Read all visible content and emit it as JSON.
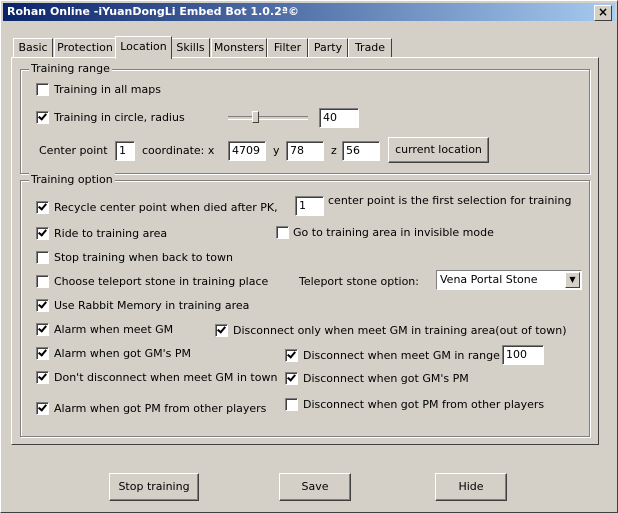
{
  "window": {
    "title": "Rohan Online -iYuanDongLi Embed Bot 1.0.2ª©",
    "close_glyph": "×"
  },
  "tabs": [
    "Basic",
    "Protection",
    "Location",
    "Skills",
    "Monsters",
    "Filter",
    "Party",
    "Trade"
  ],
  "active_tab": "Location",
  "training_range": {
    "legend": "Training range",
    "all_maps": {
      "label": "Training in all maps",
      "checked": false
    },
    "circle": {
      "label": "Training in circle, radius",
      "checked": true
    },
    "radius_slider_fraction": 0.32,
    "radius_value": "40",
    "center_point_label": "Center point",
    "center_point_value": "1",
    "coordinate_x_label": "coordinate: x",
    "x_value": "4709",
    "y_label": "y",
    "y_value": "78",
    "z_label": "z",
    "z_value": "56",
    "current_location_button": "current location"
  },
  "training_option": {
    "legend": "Training option",
    "recycle": {
      "label": "Recycle center point when died after PK,",
      "checked": true
    },
    "center_selection_value": "1",
    "center_selection_text": "center point is the first selection for training",
    "ride": {
      "label": "Ride to training area",
      "checked": true
    },
    "invisible": {
      "label": "Go to training area in invisible mode",
      "checked": false
    },
    "stop_back_town": {
      "label": "Stop training when back to town",
      "checked": false
    },
    "teleport_stone": {
      "label": "Choose teleport stone in training place",
      "checked": false
    },
    "teleport_option_label": "Teleport stone option:",
    "teleport_option_value": "Vena Portal Stone",
    "rabbit_memory": {
      "label": "Use Rabbit Memory in training area",
      "checked": true
    },
    "alarm_gm": {
      "label": "Alarm when meet GM",
      "checked": true
    },
    "disconnect_gm_area": {
      "label": "Disconnect only when meet GM in training area(out of town)",
      "checked": true
    },
    "alarm_gm_pm": {
      "label": "Alarm when got GM's PM",
      "checked": true
    },
    "disconnect_gm_range": {
      "label": "Disconnect when meet GM in range",
      "checked": true
    },
    "gm_range_value": "100",
    "no_disconnect_town": {
      "label": "Don't disconnect when meet GM in town",
      "checked": true
    },
    "disconnect_gm_pm": {
      "label": "Disconnect when got GM's PM",
      "checked": true
    },
    "alarm_pm_players": {
      "label": "Alarm when got PM from other players",
      "checked": true
    },
    "disconnect_pm_players": {
      "label": "Disconnect when got PM from other players",
      "checked": false
    }
  },
  "buttons": {
    "stop_training": "Stop training",
    "save": "Save",
    "hide": "Hide"
  }
}
